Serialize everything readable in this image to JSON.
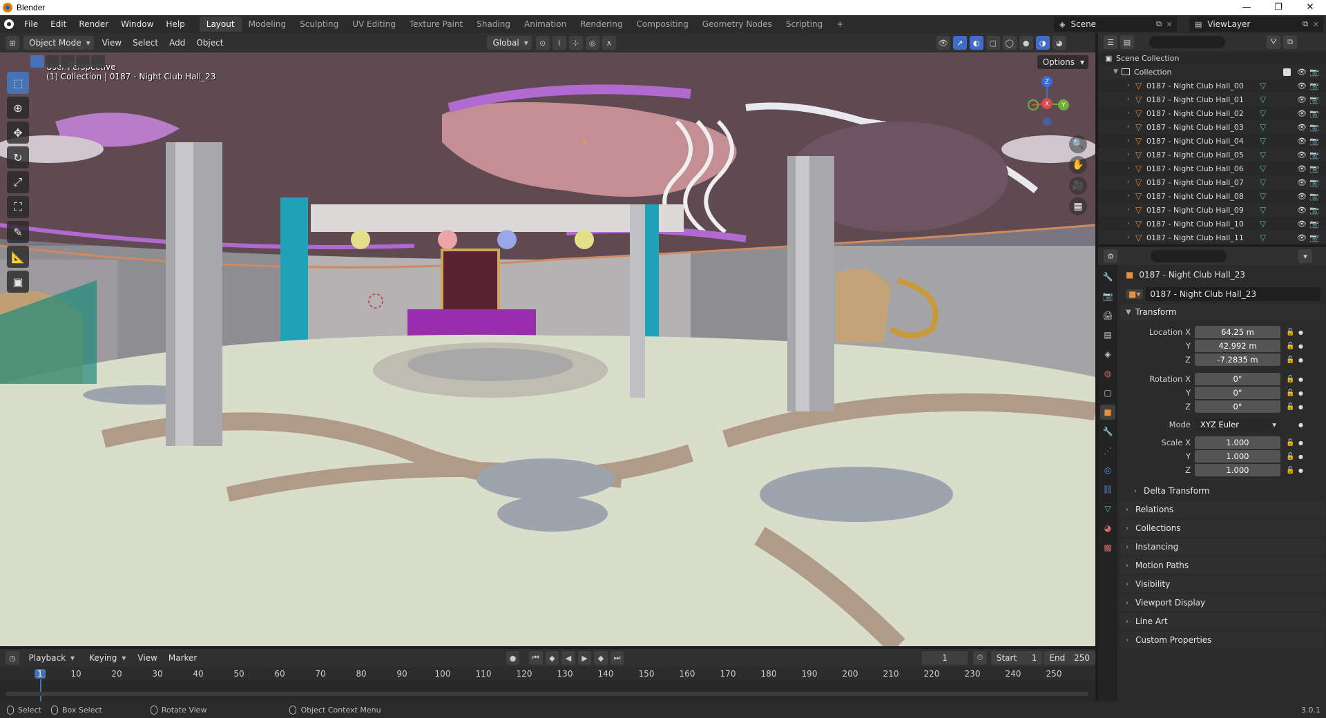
{
  "window": {
    "title": "Blender",
    "controls": [
      "—",
      "❐",
      "✕"
    ]
  },
  "menu": {
    "items": [
      "File",
      "Edit",
      "Render",
      "Window",
      "Help"
    ],
    "workspaces": [
      "Layout",
      "Modeling",
      "Sculpting",
      "UV Editing",
      "Texture Paint",
      "Shading",
      "Animation",
      "Rendering",
      "Compositing",
      "Geometry Nodes",
      "Scripting",
      "+"
    ],
    "active_workspace": "Layout",
    "scene": "Scene",
    "view_layer": "ViewLayer"
  },
  "viewport_header": {
    "mode": "Object Mode",
    "menus": [
      "View",
      "Select",
      "Add",
      "Object"
    ],
    "orientation": "Global",
    "options": "Options"
  },
  "viewport": {
    "perspective": "User Perspective",
    "context": "(1) Collection | 0187 - Night Club Hall_23",
    "gizmo_axes": [
      "Z",
      "X",
      "Y"
    ]
  },
  "timeline": {
    "menus": [
      "Playback",
      "Keying",
      "View",
      "Marker"
    ],
    "current_frame": "1",
    "start_label": "Start",
    "start": "1",
    "end_label": "End",
    "end": "250",
    "ruler": [
      "1",
      "10",
      "20",
      "30",
      "40",
      "50",
      "60",
      "70",
      "80",
      "90",
      "100",
      "110",
      "120",
      "130",
      "140",
      "150",
      "160",
      "170",
      "180",
      "190",
      "200",
      "210",
      "220",
      "230",
      "240",
      "250"
    ]
  },
  "statusbar": {
    "hints": [
      "Select",
      "Box Select",
      "Rotate View",
      "Object Context Menu"
    ],
    "version": "3.0.1"
  },
  "outliner": {
    "scene_collection": "Scene Collection",
    "collection": "Collection",
    "objects": [
      "0187 - Night Club Hall_00",
      "0187 - Night Club Hall_01",
      "0187 - Night Club Hall_02",
      "0187 - Night Club Hall_03",
      "0187 - Night Club Hall_04",
      "0187 - Night Club Hall_05",
      "0187 - Night Club Hall_06",
      "0187 - Night Club Hall_07",
      "0187 - Night Club Hall_08",
      "0187 - Night Club Hall_09",
      "0187 - Night Club Hall_10",
      "0187 - Night Club Hall_11"
    ]
  },
  "properties": {
    "object_name": "0187 - Night Club Hall_23",
    "datablock": "0187 - Night Club Hall_23",
    "transform_title": "Transform",
    "location_label": "Location X",
    "location": {
      "x": "64.25 m",
      "y": "42.992 m",
      "z": "-7.2835 m"
    },
    "rotation_label": "Rotation X",
    "rotation": {
      "x": "0°",
      "y": "0°",
      "z": "0°"
    },
    "mode_label": "Mode",
    "mode": "XYZ Euler",
    "scale_label": "Scale X",
    "scale": {
      "x": "1.000",
      "y": "1.000",
      "z": "1.000"
    },
    "axis_y": "Y",
    "axis_z": "Z",
    "delta": "Delta Transform",
    "panels": [
      "Relations",
      "Collections",
      "Instancing",
      "Motion Paths",
      "Visibility",
      "Viewport Display",
      "Line Art",
      "Custom Properties"
    ]
  }
}
